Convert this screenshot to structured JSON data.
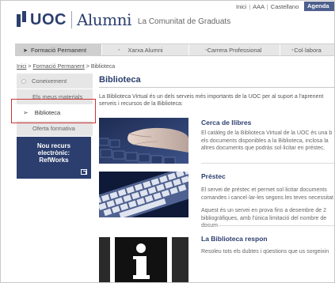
{
  "utility": {
    "links": [
      "Inici",
      "AAA",
      "Castellano"
    ],
    "agenda": "Agenda"
  },
  "logo": {
    "uoc": "UOC",
    "alumni": "Alumni",
    "tagline": "La Comunitat de Graduats"
  },
  "nav": {
    "tabs": [
      {
        "label": "Formació Permanent",
        "active": true
      },
      {
        "label": "Xarxa Alumni",
        "active": false
      },
      {
        "label": "Carrera Professional",
        "active": false
      },
      {
        "label": "Col·labora",
        "active": false
      }
    ]
  },
  "breadcrumb": {
    "items": [
      "Inici",
      "Formació Permanent",
      "Biblioteca"
    ],
    "separator": ">"
  },
  "sidebar": {
    "items": [
      {
        "label": "Coneixement"
      },
      {
        "label": "Els meus materials"
      },
      {
        "label": "Biblioteca"
      },
      {
        "label": "Oferta formativa"
      }
    ],
    "promo": {
      "line1": "Nou recurs",
      "line2": "electrònic:",
      "line3": "RefWorks"
    }
  },
  "main": {
    "title": "Biblioteca",
    "intro_line1": "La Biblioteca Virtual és un dels serveis més importants de la UOC per al suport a l'aprenent",
    "intro_line2": "serveis i recursos de la Biblioteca:",
    "sections": [
      {
        "heading": "Cerca de llibres",
        "lines": [
          "El catàleg de la Biblioteca Virtual de la UOC és una b",
          "els documents disponibles a la Biblioteca, inclosa la",
          "altres documents que podràs sol·licitar en préstec."
        ]
      },
      {
        "heading": "Préstec",
        "lines": [
          "El servei de préstec et permet sol·licitar documents",
          "comandes i cancel·lar-les segons les teves necessitat"
        ],
        "lines2": [
          "Aquest és un servei en prova fins a desembre de 2",
          "bibliogràfiques, amb l'única limitació del nombre de docum"
        ]
      },
      {
        "heading": "La Biblioteca respon",
        "lines": [
          "Resoleu tots els dubtes i qüestions que us sorgeixin"
        ]
      }
    ]
  },
  "colors": {
    "brand": "#2b3e6e",
    "highlight": "#cc3333",
    "nav_bg": "#e6e6e6"
  }
}
